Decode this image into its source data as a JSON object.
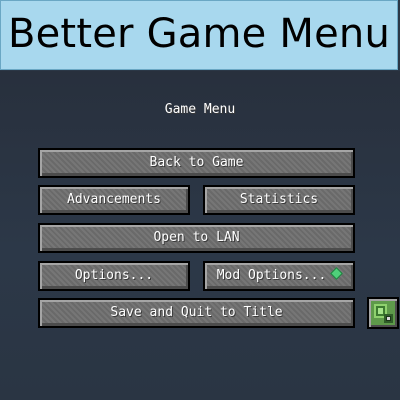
{
  "banner": {
    "title": "Better Game Menu"
  },
  "menu": {
    "title": "Game Menu",
    "buttons": {
      "back_to_game": "Back to Game",
      "advancements": "Advancements",
      "statistics": "Statistics",
      "open_to_lan": "Open to LAN",
      "options": "Options...",
      "mod_options": "Mod Options...",
      "save_and_quit": "Save and Quit to Title"
    },
    "icons": {
      "mod_options_gem": "emerald-gem-icon",
      "feedback_button": "world-map-icon"
    }
  },
  "colors": {
    "banner_bg": "#a8d8ee",
    "game_bg": "#2b3746",
    "button_face": "#6f6f6f",
    "button_text": "#ffffff"
  }
}
